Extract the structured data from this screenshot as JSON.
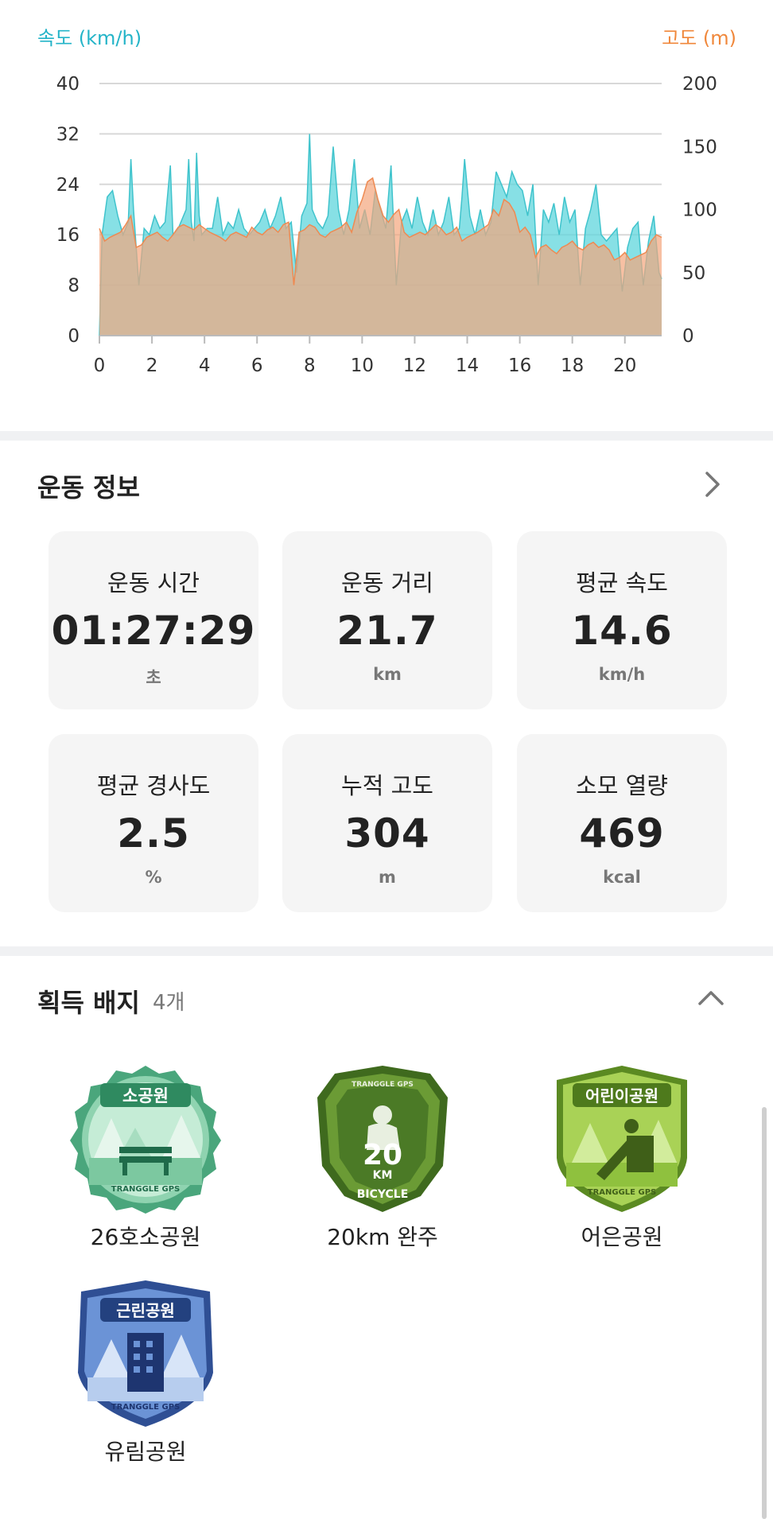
{
  "chart_data": {
    "type": "area",
    "y_left_label": "속도 (km/h)",
    "y_right_label": "고도 (m)",
    "x_ticks": [
      "0",
      "2",
      "4",
      "6",
      "8",
      "10",
      "12",
      "14",
      "16",
      "18",
      "20"
    ],
    "y_left_ticks": [
      "0",
      "8",
      "16",
      "24",
      "32",
      "40"
    ],
    "y_right_ticks": [
      "0",
      "50",
      "100",
      "150",
      "200"
    ],
    "xlim": [
      0,
      21.4
    ],
    "y_left_lim": [
      0,
      40
    ],
    "y_right_lim": [
      0,
      200
    ],
    "grid": true,
    "series": [
      {
        "name": "속도 (km/h)",
        "axis": "left",
        "color": "#5fd6dc",
        "x": [
          0,
          0.1,
          0.3,
          0.5,
          0.7,
          0.9,
          1.1,
          1.2,
          1.3,
          1.5,
          1.7,
          1.9,
          2.1,
          2.3,
          2.5,
          2.7,
          2.8,
          3.0,
          3.1,
          3.3,
          3.4,
          3.5,
          3.6,
          3.7,
          3.8,
          3.9,
          4.1,
          4.3,
          4.5,
          4.7,
          4.9,
          5.1,
          5.3,
          5.5,
          5.7,
          5.9,
          6.1,
          6.3,
          6.5,
          6.7,
          6.9,
          7.1,
          7.3,
          7.5,
          7.7,
          7.9,
          8.0,
          8.1,
          8.3,
          8.5,
          8.7,
          8.9,
          9.1,
          9.3,
          9.5,
          9.7,
          9.9,
          10.1,
          10.3,
          10.5,
          10.7,
          10.9,
          11.1,
          11.3,
          11.5,
          11.7,
          11.9,
          12.1,
          12.3,
          12.5,
          12.7,
          12.9,
          13.1,
          13.3,
          13.5,
          13.7,
          13.8,
          13.9,
          14.1,
          14.3,
          14.5,
          14.7,
          14.9,
          15.1,
          15.3,
          15.5,
          15.7,
          15.9,
          16.1,
          16.3,
          16.5,
          16.7,
          16.9,
          17.1,
          17.3,
          17.5,
          17.7,
          17.9,
          18.1,
          18.3,
          18.5,
          18.7,
          18.9,
          19.1,
          19.3,
          19.5,
          19.7,
          19.9,
          20.1,
          20.3,
          20.5,
          20.7,
          20.9,
          21.1,
          21.3,
          21.4
        ],
        "values": [
          0,
          16,
          22,
          23,
          19,
          16,
          18,
          28,
          20,
          8,
          17,
          16,
          19,
          17,
          18,
          27,
          16,
          17,
          18,
          20,
          28,
          18,
          15,
          29,
          19,
          16,
          17,
          17,
          22,
          16,
          18,
          17,
          20,
          17,
          16,
          17,
          18,
          20,
          17,
          19,
          22,
          17,
          18,
          10,
          19,
          21,
          32,
          20,
          18,
          17,
          19,
          30,
          20,
          16,
          20,
          28,
          17,
          20,
          16,
          23,
          20,
          17,
          27,
          8,
          18,
          20,
          17,
          22,
          18,
          16,
          20,
          16,
          18,
          22,
          16,
          17,
          22,
          28,
          19,
          16,
          20,
          16,
          18,
          26,
          24,
          22,
          26,
          24,
          23,
          19,
          24,
          8,
          20,
          18,
          21,
          16,
          22,
          18,
          20,
          8,
          17,
          20,
          24,
          16,
          15,
          16,
          17,
          7,
          14,
          17,
          18,
          8,
          15,
          19,
          10,
          9
        ]
      },
      {
        "name": "고도 (m)",
        "axis": "right",
        "color": "#f4a57c",
        "x": [
          0,
          0.2,
          0.4,
          0.6,
          0.8,
          1.0,
          1.2,
          1.4,
          1.6,
          1.8,
          2.0,
          2.2,
          2.4,
          2.6,
          2.8,
          3.0,
          3.2,
          3.4,
          3.6,
          3.8,
          4.0,
          4.2,
          4.4,
          4.6,
          4.8,
          5.0,
          5.2,
          5.4,
          5.6,
          5.8,
          6.0,
          6.2,
          6.4,
          6.6,
          6.8,
          7.0,
          7.2,
          7.4,
          7.6,
          7.8,
          8.0,
          8.2,
          8.4,
          8.6,
          8.8,
          9.0,
          9.2,
          9.4,
          9.6,
          9.8,
          10.0,
          10.2,
          10.4,
          10.6,
          10.8,
          11.0,
          11.2,
          11.4,
          11.6,
          11.8,
          12.0,
          12.2,
          12.4,
          12.6,
          12.8,
          13.0,
          13.2,
          13.4,
          13.6,
          13.8,
          14.0,
          14.2,
          14.4,
          14.6,
          14.8,
          15.0,
          15.2,
          15.4,
          15.6,
          15.8,
          16.0,
          16.2,
          16.4,
          16.6,
          16.8,
          17.0,
          17.2,
          17.4,
          17.6,
          17.8,
          18.0,
          18.2,
          18.4,
          18.6,
          18.8,
          19.0,
          19.2,
          19.4,
          19.6,
          19.8,
          20.0,
          20.2,
          20.4,
          20.6,
          20.8,
          21.0,
          21.2,
          21.4
        ],
        "values": [
          85,
          75,
          78,
          80,
          82,
          88,
          95,
          70,
          72,
          78,
          80,
          82,
          78,
          75,
          80,
          86,
          88,
          86,
          84,
          88,
          85,
          82,
          80,
          78,
          75,
          80,
          82,
          80,
          78,
          86,
          82,
          80,
          84,
          86,
          82,
          88,
          90,
          40,
          82,
          84,
          88,
          86,
          80,
          78,
          82,
          84,
          86,
          90,
          82,
          98,
          108,
          122,
          125,
          108,
          95,
          90,
          96,
          100,
          82,
          78,
          80,
          82,
          80,
          84,
          88,
          85,
          80,
          82,
          86,
          75,
          78,
          80,
          82,
          85,
          88,
          100,
          95,
          108,
          105,
          98,
          82,
          86,
          80,
          62,
          70,
          72,
          68,
          65,
          70,
          72,
          75,
          70,
          68,
          72,
          74,
          70,
          72,
          68,
          60,
          62,
          66,
          60,
          62,
          64,
          66,
          75,
          80,
          78
        ]
      }
    ]
  },
  "exercise": {
    "title": "운동 정보",
    "cards": [
      {
        "label": "운동 시간",
        "value": "01:27:29",
        "unit": "초"
      },
      {
        "label": "운동 거리",
        "value": "21.7",
        "unit": "km"
      },
      {
        "label": "평균 속도",
        "value": "14.6",
        "unit": "km/h"
      },
      {
        "label": "평균 경사도",
        "value": "2.5",
        "unit": "%"
      },
      {
        "label": "누적 고도",
        "value": "304",
        "unit": "m"
      },
      {
        "label": "소모 열량",
        "value": "469",
        "unit": "kcal"
      }
    ]
  },
  "badges": {
    "title": "획득 배지",
    "count": "4개",
    "items": [
      {
        "name": "26호소공원",
        "emblem_text": "소공원",
        "brand": "TRANGGLE GPS",
        "icon": "bench-icon",
        "color": "#5fb98f"
      },
      {
        "name": "20km 완주",
        "emblem_text": "20",
        "emblem_sub": "KM",
        "ribbon": "BICYCLE",
        "brand": "TRANGGLE GPS",
        "icon": "cyclist-icon",
        "color": "#5c8a2c"
      },
      {
        "name": "어은공원",
        "emblem_text": "어린이공원",
        "brand": "TRANGGLE GPS",
        "icon": "slide-icon",
        "color": "#8ebc3a"
      },
      {
        "name": "유림공원",
        "emblem_text": "근린공원",
        "brand": "TRANGGLE GPS",
        "icon": "building-icon",
        "color": "#3a67b4"
      }
    ]
  }
}
